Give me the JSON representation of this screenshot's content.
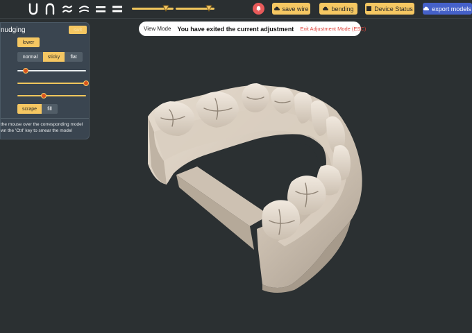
{
  "toolbar": {
    "tools": [
      {
        "icon": "u-curve-icon"
      },
      {
        "icon": "arch-curve-icon"
      },
      {
        "icon": "wave-lines-icon"
      },
      {
        "icon": "double-curve-icon"
      },
      {
        "icon": "equal-lines-icon"
      },
      {
        "icon": "double-bars-icon"
      }
    ],
    "sliders": [
      {
        "level": 0.8
      },
      {
        "level": 0.82
      }
    ],
    "bell_icon": "bell-icon",
    "save_wire": "save wire",
    "bending": "bending",
    "device_status": "Device Status",
    "export_models": "export models"
  },
  "panel": {
    "title": "nudging",
    "header_button": "swit",
    "lower": "lower",
    "modes": {
      "normal": "normal",
      "sticky": "sticky",
      "flat": "flat",
      "selected": "sticky"
    },
    "sliders": [
      {
        "level": 0.12
      },
      {
        "level": 1.0
      },
      {
        "level": 0.38
      }
    ],
    "actions": {
      "scrape": "scrape",
      "fill": "fill",
      "selected": "scrape"
    },
    "hint_line1": "the mouse over the corresponding model",
    "hint_line2": "wn the 'Ctrl' key to smear the model"
  },
  "status": {
    "mode": "View Mode",
    "message": "You have exited the current adjustment",
    "exit": "Exit Adjustment Mode (ESC)"
  },
  "colors": {
    "background": "#2b3032",
    "accent": "#f5c762",
    "panel": "#3a4550",
    "export": "#4561c9",
    "alert": "#e85a5a",
    "model": "#d8cdbf"
  },
  "model": {
    "name": "dental-arch-model"
  }
}
